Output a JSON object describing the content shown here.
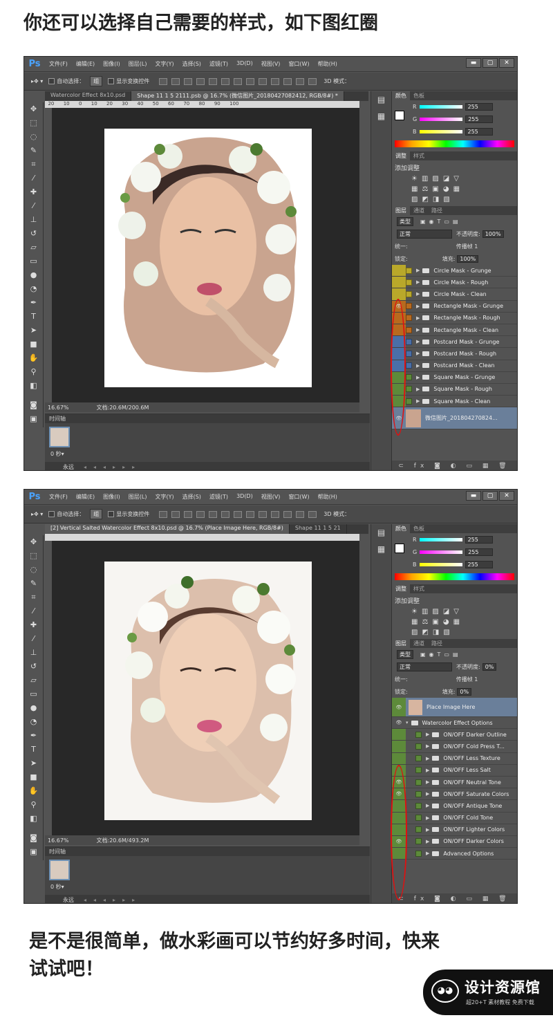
{
  "heading_top": "你还可以选择自己需要的样式，如下图红圈",
  "heading_bottom_line1": "是不是很简单，做水彩画可以节约好多时间，快来",
  "heading_bottom_line2": "试试吧！",
  "ps_logo": "Ps",
  "menu": [
    "文件(F)",
    "编辑(E)",
    "图像(I)",
    "图层(L)",
    "文字(Y)",
    "选择(S)",
    "滤镜(T)",
    "3D(D)",
    "视图(V)",
    "窗口(W)",
    "帮助(H)"
  ],
  "winbtns": [
    "▬",
    "▢",
    "✕"
  ],
  "options": {
    "auto_select": "自动选择：",
    "group": "组",
    "show_transform": "显示变换控件",
    "mode3d": "3D 模式："
  },
  "color_tab": "颜色",
  "swatch_tab": "色板",
  "adj_tab": "调整",
  "style_tab": "样式",
  "add_adjust": "添加调整",
  "layers_tab": "图层",
  "channels_tab": "通道",
  "paths_tab": "路径",
  "kind": "类型",
  "blend": "正常",
  "opacity_label": "不透明度:",
  "lock_label": "锁定:",
  "fill_label": "填充:",
  "unify_label": "统一:",
  "propagate": "传播帧 1",
  "rgb": {
    "r": "R",
    "g": "G",
    "b": "B",
    "rv": "255",
    "gv": "255",
    "bv": "255"
  },
  "timeline_label": "时间轴",
  "frame_time": "0 秒▾",
  "loop": "永远",
  "shot1": {
    "tabs": [
      "Watercolor Effect 8x10.psd",
      "Shape 11 1 5 2111.psb @ 16.7% (微信图片_20180427082412, RGB/8#) *"
    ],
    "zoom": "16.67%",
    "docsize": "文档:20.6M/200.6M",
    "opacity": "100%",
    "fill": "100%",
    "layers": [
      {
        "name": "Circle Mask - Grunge",
        "color": "#b9a82a",
        "eye": ""
      },
      {
        "name": "Circle Mask - Rough",
        "color": "#b9a82a",
        "eye": ""
      },
      {
        "name": "Circle Mask - Clean",
        "color": "#b9a82a",
        "eye": ""
      },
      {
        "name": "Rectangle Mask - Grunge",
        "color": "#b86a1e",
        "eye": "👁"
      },
      {
        "name": "Rectangle Mask - Rough",
        "color": "#b86a1e",
        "eye": ""
      },
      {
        "name": "Rectangle Mask - Clean",
        "color": "#b86a1e",
        "eye": ""
      },
      {
        "name": "Postcard Mask - Grunge",
        "color": "#4a6fa8",
        "eye": ""
      },
      {
        "name": "Postcard Mask - Rough",
        "color": "#4a6fa8",
        "eye": ""
      },
      {
        "name": "Postcard Mask - Clean",
        "color": "#4a6fa8",
        "eye": ""
      },
      {
        "name": "Square Mask - Grunge",
        "color": "#5d8a3a",
        "eye": ""
      },
      {
        "name": "Square Mask - Rough",
        "color": "#5d8a3a",
        "eye": ""
      },
      {
        "name": "Square Mask - Clean",
        "color": "#5d8a3a",
        "eye": ""
      }
    ],
    "photo_layer": "微信图片_201804270824..."
  },
  "shot2": {
    "tabs": [
      "[2] Vertical Salted Watercolor Effect 8x10.psd @ 16.7% (Place Image Here, RGB/8#)",
      "Shape 11 1 5 21"
    ],
    "zoom": "16.67%",
    "docsize": "文档:20.6M/493.2M",
    "opacity": "0%",
    "fill": "0%",
    "place_layer": "Place Image Here",
    "group_layer": "Watercolor Effect Options",
    "layers": [
      {
        "name": "ON/OFF Darker Outline",
        "eye": ""
      },
      {
        "name": "ON/OFF Cold Press T...",
        "eye": ""
      },
      {
        "name": "ON/OFF Less Texture",
        "eye": ""
      },
      {
        "name": "ON/OFF Less Salt",
        "eye": ""
      },
      {
        "name": "ON/OFF Neutral Tone",
        "eye": "👁"
      },
      {
        "name": "ON/OFF Saturate Colors",
        "eye": "👁"
      },
      {
        "name": "ON/OFF Antique Tone",
        "eye": ""
      },
      {
        "name": "ON/OFF Cold Tone",
        "eye": ""
      },
      {
        "name": "ON/OFF Lighter Colors",
        "eye": ""
      },
      {
        "name": "ON/OFF Darker Colors",
        "eye": "👁"
      },
      {
        "name": "Advanced Options",
        "eye": ""
      }
    ]
  },
  "watermark_name": "设计资源馆",
  "watermark_sub": "超20+T 素材教程 免费下载",
  "colors": {
    "accent_red": "#e01010",
    "ps_gray": "#535353",
    "green_label": "#5d8a3a"
  }
}
